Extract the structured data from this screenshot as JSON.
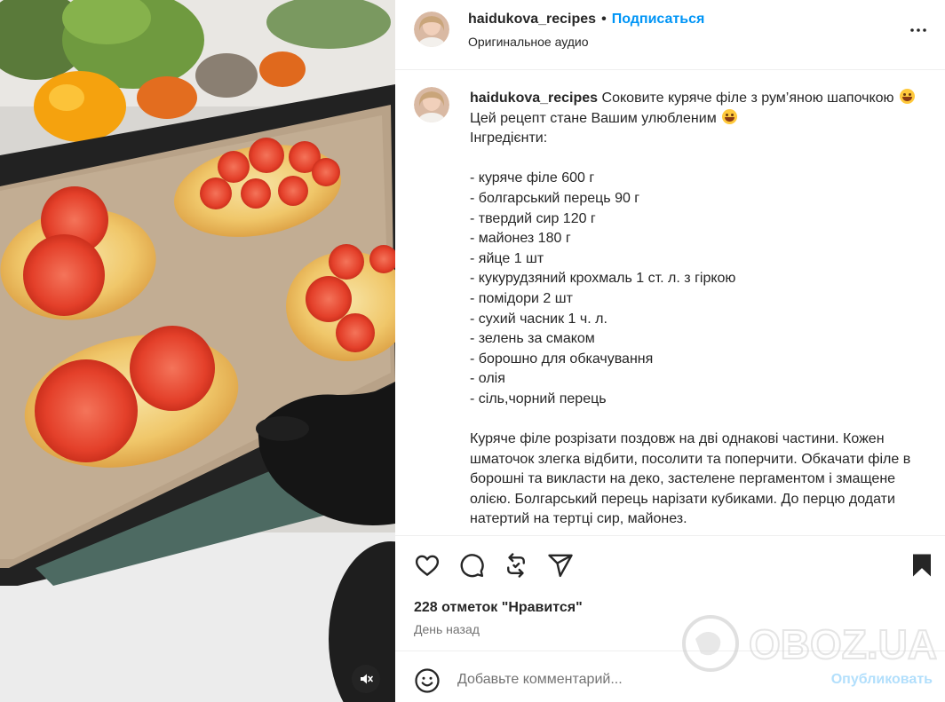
{
  "post": {
    "username": "haidukova_recipes",
    "follow_label": "Подписаться",
    "audio_label": "Оригинальное аудио",
    "caption": {
      "title": "Соковите куряче філе з рум’яною шапочкою",
      "intro": "Цей рецепт стане Вашим улюбленим",
      "ingredients_heading": "Інгредієнти:",
      "ingredients": [
        "- куряче філе 600 г",
        "- болгарський перець 90 г",
        "- твердий сир 120 г",
        "- майонез 180 г",
        "- яйце 1 шт",
        "- кукурудзяний крохмаль 1 ст. л. з гіркою",
        "- помідори 2 шт",
        "- сухий часник 1 ч. л.",
        "- зелень за смаком",
        "- борошно для обкачування",
        "- олія",
        "- сіль,чорний перець"
      ],
      "method": "Куряче філе розрізати поздовж на дві однакові частини. Кожен шматочок злегка відбити, посолити та поперчити. Обкачати філе в борошні та викласти на деко, застелене пергаментом і змащене олією. Болгарський перець нарізати кубиками. До перцю додати натертий на тертці сир, майонез."
    },
    "likes_text": "228 отметок \"Нравится\"",
    "time_text": "День назад"
  },
  "comment": {
    "placeholder": "Добавьте комментарий...",
    "publish_label": "Опубликовать"
  },
  "watermark": {
    "text": "OBOZ.UA"
  },
  "icons": {
    "more": "more-options-icon",
    "like": "heart-icon",
    "comment": "comment-icon",
    "repost": "repost-icon",
    "share": "share-icon",
    "save": "bookmark-icon",
    "emoji": "emoji-icon",
    "mute": "mute-icon"
  },
  "colors": {
    "link": "#0095f6",
    "publish_disabled": "#b2dffc",
    "secondary_text": "#737373"
  }
}
